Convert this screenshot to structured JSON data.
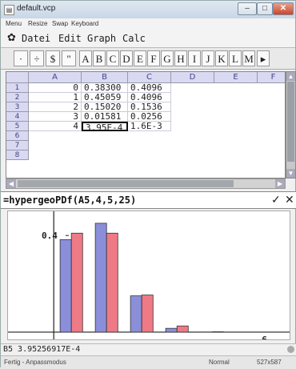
{
  "window": {
    "title": "default.vcp",
    "min_label": "–",
    "max_label": "□",
    "close_label": "✕"
  },
  "menu_small": [
    "Menu",
    "Resize",
    "Swap",
    "Keyboard"
  ],
  "menu": {
    "option_glyph": "✿",
    "items": [
      "Datei",
      "Edit",
      "Graph",
      "Calc"
    ]
  },
  "toolbar": {
    "buttons": [
      "·",
      "÷",
      "$",
      "\"",
      "A",
      "B",
      "C",
      "D",
      "E",
      "F",
      "G",
      "H",
      "I",
      "J",
      "K",
      "L",
      "M",
      "▸"
    ]
  },
  "spreadsheet": {
    "columns": [
      "A",
      "B",
      "C",
      "D",
      "E",
      "F"
    ],
    "rows": [
      "1",
      "2",
      "3",
      "4",
      "5",
      "6",
      "7",
      "8"
    ],
    "cells": [
      [
        "0",
        "0.38300",
        "0.4096"
      ],
      [
        "1",
        "0.45059",
        "0.4096"
      ],
      [
        "2",
        "0.15020",
        "0.1536"
      ],
      [
        "3",
        "0.01581",
        "0.0256"
      ],
      [
        "4",
        "3.95E-4",
        "1.6E-3"
      ]
    ]
  },
  "formula": {
    "text": "=hypergeoPDf(A5,4,5,25)",
    "ok_glyph": "✓",
    "cancel_glyph": "✕"
  },
  "chart_data": {
    "type": "bar",
    "categories": [
      "0",
      "1",
      "2",
      "3",
      "4"
    ],
    "series": [
      {
        "values": [
          0.383,
          0.45059,
          0.1502,
          0.01581,
          0.000395
        ],
        "color": "#8b8fd9"
      },
      {
        "values": [
          0.4096,
          0.4096,
          0.1536,
          0.0256,
          0.0016
        ],
        "color": "#ee7a86"
      }
    ],
    "ytick_label": "0.4",
    "xtick_label": "6",
    "xlim": [
      -1.3,
      6.7
    ],
    "ylim": [
      -0.03,
      0.5
    ]
  },
  "status": {
    "cell_value": "B5 3.95256917E-4",
    "mode": "Fertig - Anpassmodus",
    "format": "Normal",
    "size": "527x587"
  }
}
